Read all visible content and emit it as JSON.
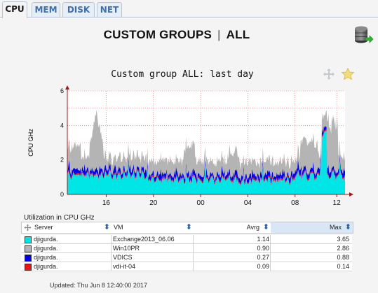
{
  "tabs": [
    "CPU",
    "MEM",
    "DISK",
    "NET"
  ],
  "page_title": {
    "left": "CUSTOM GROUPS",
    "separator": "|",
    "right": "ALL"
  },
  "chart_title": "Custom group ALL: last day",
  "icons": {
    "db": "database-export-icon",
    "move": "move-icon",
    "star": "favorite-star-icon"
  },
  "chart_data": {
    "type": "area",
    "title": "Custom group ALL: last day",
    "xlabel": "",
    "ylabel": "CPU GHz",
    "x_tick_labels": [
      "16",
      "20",
      "00",
      "04",
      "08",
      "12"
    ],
    "y_tick_labels": [
      "0",
      "2",
      "4",
      "6"
    ],
    "ylim": [
      0,
      6
    ],
    "stacked": true,
    "grid": true,
    "series": [
      {
        "name": "Exchange2013_06.06",
        "color": "#00e5e5",
        "avg": 1.14,
        "max": 3.65
      },
      {
        "name": "Win10PR",
        "color": "#b4b4b4",
        "avg": 0.9,
        "max": 2.86
      },
      {
        "name": "VDICS",
        "color": "#0000ee",
        "avg": 0.27,
        "max": 0.88
      },
      {
        "name": "vdi-it-04",
        "color": "#ee1111",
        "avg": 0.09,
        "max": 0.14
      }
    ]
  },
  "table": {
    "caption": "Utilization in CPU GHz",
    "headers": {
      "server": "Server",
      "vm": "VM",
      "avg": "Avrg",
      "max": "Max"
    },
    "rows": [
      {
        "color": "#00e5e5",
        "server": "djigurda.",
        "vm": "Exchange2013_06.06",
        "avg": "1.14",
        "max": "3.65"
      },
      {
        "color": "#b4b4b4",
        "server": "djigurda.",
        "vm": "Win10PR",
        "avg": "0.90",
        "max": "2.86"
      },
      {
        "color": "#0000ee",
        "server": "djigurda.",
        "vm": "VDICS",
        "avg": "0.27",
        "max": "0.88"
      },
      {
        "color": "#ee1111",
        "server": "djigurda.",
        "vm": "vdi-it-04",
        "avg": "0.09",
        "max": "0.14"
      }
    ]
  },
  "updated": "Updated: Thu Jun 8 12:40:00 2017"
}
